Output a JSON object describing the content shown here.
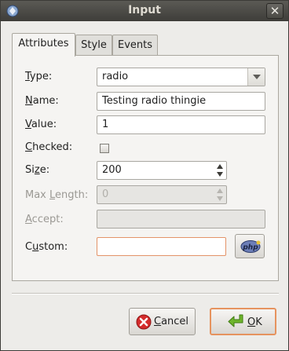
{
  "window": {
    "title": "Input",
    "close_glyph": "✕"
  },
  "tabs": [
    {
      "label": "Attributes"
    },
    {
      "label": "Style"
    },
    {
      "label": "Events"
    }
  ],
  "form": {
    "type": {
      "label_mnemonic": "T",
      "label_rest": "ype:",
      "value": "radio"
    },
    "name": {
      "label_mnemonic": "N",
      "label_rest": "ame:",
      "value": "Testing radio thingie"
    },
    "value": {
      "label_mnemonic": "V",
      "label_rest": "alue:",
      "value": "1"
    },
    "checked": {
      "label_mnemonic": "C",
      "label_rest": "hecked:",
      "checked": false
    },
    "size": {
      "label_pre": "Si",
      "label_mnemonic": "z",
      "label_rest": "e:",
      "value": "200"
    },
    "max_length": {
      "label_pre": "Max ",
      "label_mnemonic": "L",
      "label_rest": "ength:",
      "value": "0"
    },
    "accept": {
      "label_mnemonic": "A",
      "label_rest": "ccept:",
      "value": ""
    },
    "custom": {
      "label_pre": "C",
      "label_mnemonic": "u",
      "label_rest": "stom:",
      "value": ""
    }
  },
  "php_button": {
    "text": "php"
  },
  "buttons": {
    "cancel": {
      "mnemonic": "C",
      "rest": "ancel"
    },
    "ok": {
      "mnemonic": "O",
      "rest": "K"
    }
  },
  "colors": {
    "titlebar": "#3e3d39",
    "focus_border": "#e6935e",
    "cancel_icon": "#d42c2c",
    "ok_icon": "#6fb52c"
  },
  "icons": {
    "app": "app-icon",
    "close": "close-icon",
    "combo": "chevron-down-icon",
    "spin_up": "spin-up-icon",
    "spin_down": "spin-down-icon",
    "php": "php-icon",
    "cancel": "cancel-icon",
    "ok": "ok-arrow-icon"
  }
}
